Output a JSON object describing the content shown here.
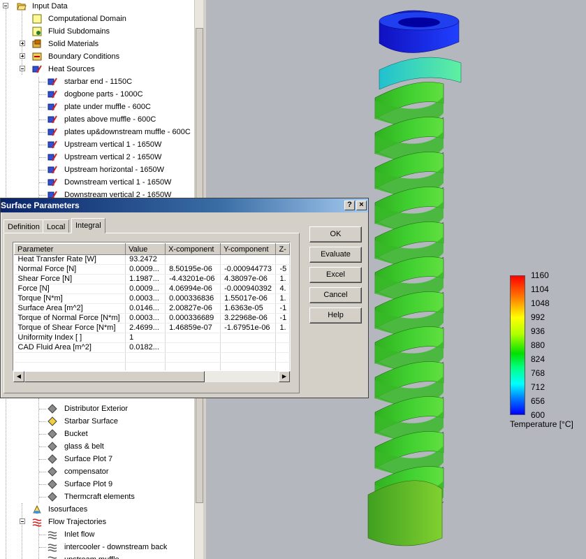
{
  "tree": {
    "top_items": [
      {
        "label": "Input Data",
        "icon": "folder-open-icon"
      },
      {
        "label": "Computational Domain",
        "icon": "domain-box-icon"
      },
      {
        "label": "Fluid Subdomains",
        "icon": "fluid-subdomain-icon"
      },
      {
        "label": "Solid Materials",
        "icon": "solid-material-icon"
      },
      {
        "label": "Boundary Conditions",
        "icon": "boundary-conditions-icon"
      },
      {
        "label": "Heat Sources",
        "icon": "heat-source-icon"
      }
    ],
    "heat_sources": [
      "starbar end - 1150C",
      "dogbone parts - 1000C",
      "plate under muffle - 600C",
      "plates above muffle - 600C",
      "plates up&downstream muffle - 600C",
      "Upstream vertical 1 - 1650W",
      "Upstream vertical 2 - 1650W",
      "Upstream horizontal - 1650W",
      "Downstream vertical 1 - 1650W",
      "Downstream vertical 2 - 1650W"
    ],
    "surface_plots": [
      "Distributor Exterior",
      "Starbar Surface",
      "Bucket",
      "glass & belt",
      "Surface Plot 7",
      "compensator",
      "Surface Plot 9",
      "Thermcraft elements"
    ],
    "bottom_items": [
      {
        "label": "Isosurfaces",
        "icon": "isosurface-icon"
      },
      {
        "label": "Flow Trajectories",
        "icon": "flow-trajectories-icon"
      }
    ],
    "trajectories": [
      "Inlet flow",
      "intercooler - downstream back",
      "upstream muffle"
    ]
  },
  "dialog": {
    "title": "Surface Parameters",
    "help_glyph": "?",
    "close_glyph": "×",
    "tabs": [
      "Definition",
      "Local",
      "Integral"
    ],
    "active_tab": "Integral",
    "columns": [
      "Parameter",
      "Value",
      "X-component",
      "Y-component",
      "Z-"
    ],
    "rows": [
      [
        "Heat Transfer Rate [W]",
        "93.2472",
        "",
        "",
        ""
      ],
      [
        "Normal Force [N]",
        "0.0009...",
        "8.50195e-06",
        "-0.000944773",
        "-5"
      ],
      [
        "Shear Force [N]",
        "1.1987...",
        "-4.43201e-06",
        "4.38097e-06",
        "1."
      ],
      [
        "Force [N]",
        "0.0009...",
        "4.06994e-06",
        "-0.000940392",
        "4."
      ],
      [
        "Torque [N*m]",
        "0.0003...",
        "0.000336836",
        "1.55017e-06",
        "1."
      ],
      [
        "Surface Area [m^2]",
        "0.0146...",
        "2.00827e-06",
        "1.6363e-05",
        "-1"
      ],
      [
        "Torque of Normal Force [N*m]",
        "0.0003...",
        "0.000336689",
        "3.22968e-06",
        "-1"
      ],
      [
        "Torque of Shear Force [N*m]",
        "2.4699...",
        "1.46859e-07",
        "-1.67951e-06",
        "1."
      ],
      [
        "Uniformity Index [ ]",
        "1",
        "",
        "",
        ""
      ],
      [
        "CAD Fluid Area [m^2]",
        "0.0182...",
        "",
        "",
        ""
      ],
      [
        "",
        "",
        "",
        "",
        ""
      ],
      [
        "",
        "",
        "",
        "",
        ""
      ]
    ],
    "buttons": {
      "ok": "OK",
      "evaluate": "Evaluate",
      "excel": "Excel",
      "cancel": "Cancel",
      "help": "Help"
    },
    "scroll_left": "◀",
    "scroll_right": "▶"
  },
  "legend": {
    "title": "Temperature [°C]",
    "ticks": [
      "1160",
      "1104",
      "1048",
      "992",
      "936",
      "880",
      "824",
      "768",
      "712",
      "656",
      "600"
    ],
    "colors": {
      "max": "#ff0000",
      "mid": "#00e000",
      "min": "#0000ff"
    }
  },
  "colors": {
    "viewport_bg": "#b5b7bf",
    "titlebar_start": "#0a246a",
    "dialog_face": "#d4d0c8"
  }
}
